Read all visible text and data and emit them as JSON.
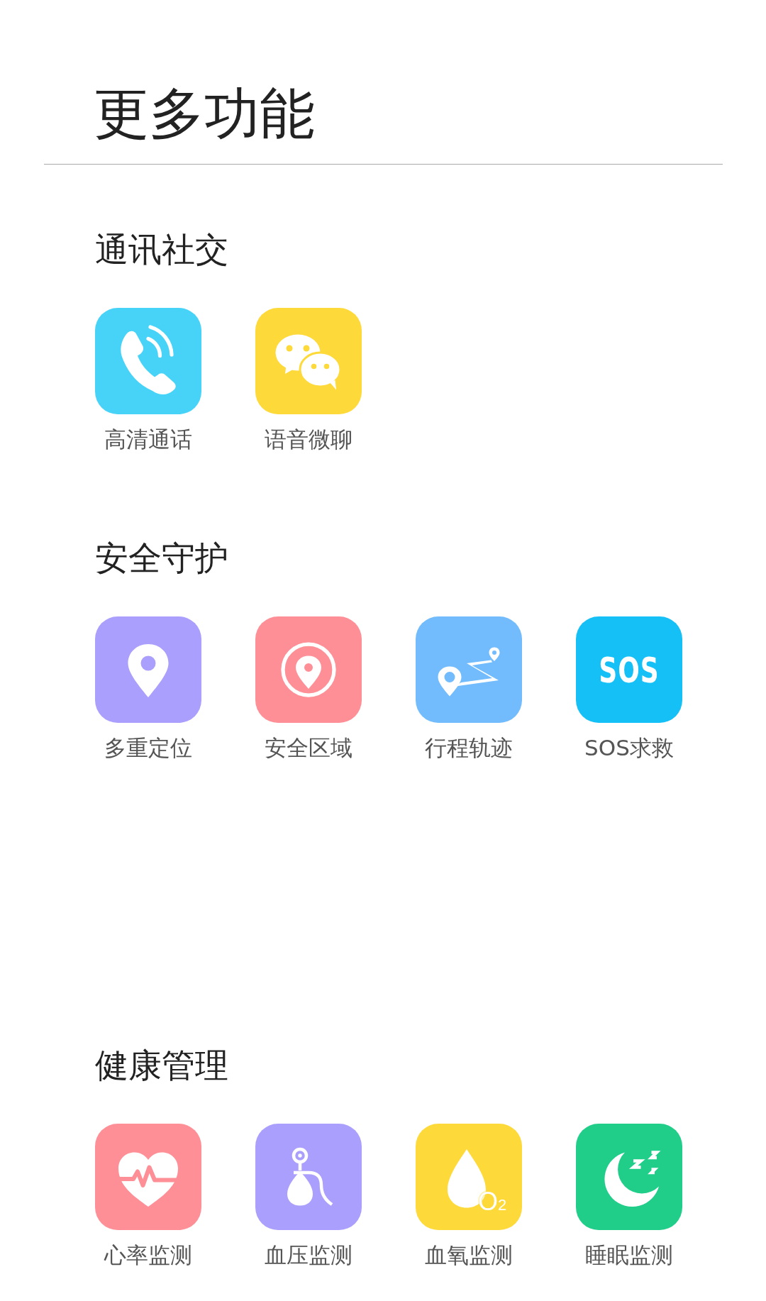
{
  "title": "更多功能",
  "sections": [
    {
      "title": "通讯社交",
      "items": [
        {
          "label": "高清通话",
          "kind": "phone",
          "color": "#47d3f8"
        },
        {
          "label": "语音微聊",
          "kind": "chat",
          "color": "#fed93a"
        }
      ]
    },
    {
      "title": "安全守护",
      "items": [
        {
          "label": "多重定位",
          "kind": "pin",
          "color": "#ab9ffd"
        },
        {
          "label": "安全区域",
          "kind": "zone",
          "color": "#ff8f96"
        },
        {
          "label": "行程轨迹",
          "kind": "route",
          "color": "#72bcfd"
        },
        {
          "label": "SOS求救",
          "kind": "sos",
          "color": "#14c0f6",
          "icon_text": "SOS"
        }
      ]
    },
    {
      "title": "健康管理",
      "items": [
        {
          "label": "心率监测",
          "kind": "heart",
          "color": "#ff8f96"
        },
        {
          "label": "血压监测",
          "kind": "pressure",
          "color": "#ab9ffd"
        },
        {
          "label": "血氧监测",
          "kind": "oxygen",
          "color": "#fed93a",
          "icon_text": "O$_{2}$"
        },
        {
          "label": "睡眠监测",
          "kind": "sleep",
          "color": "#21ce89"
        }
      ]
    }
  ]
}
